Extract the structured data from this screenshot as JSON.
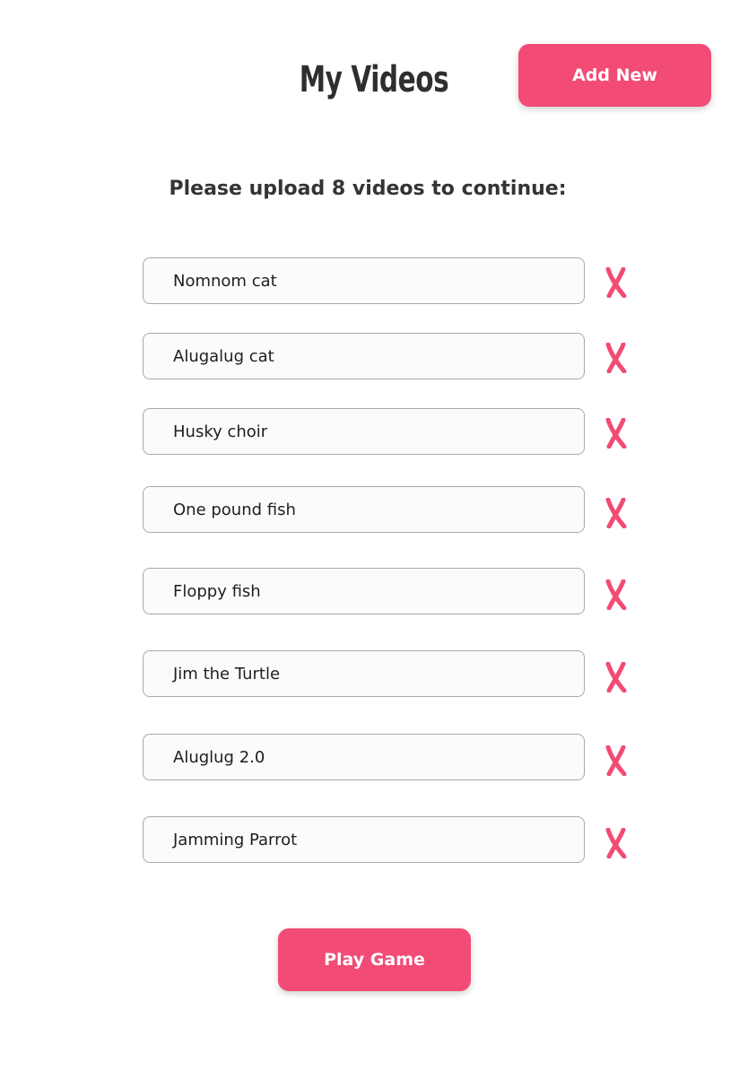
{
  "header": {
    "title": "My Videos",
    "add_new_label": "Add New"
  },
  "instruction": "Please upload 8 videos to continue:",
  "videos": [
    {
      "title": "Nomnom cat"
    },
    {
      "title": "Alugalug cat"
    },
    {
      "title": "Husky choir"
    },
    {
      "title": "One pound fish"
    },
    {
      "title": "Floppy fish"
    },
    {
      "title": "Jim the Turtle"
    },
    {
      "title": "Aluglug 2.0"
    },
    {
      "title": "Jamming Parrot"
    }
  ],
  "delete_icon": "cross-mark-icon",
  "play_button_label": "Play Game",
  "colors": {
    "accent": "#f24b75",
    "background": "#ffffff",
    "input_border": "#a9a9a9",
    "input_background": "#fbfbfb",
    "text": "#2f2f2f"
  }
}
